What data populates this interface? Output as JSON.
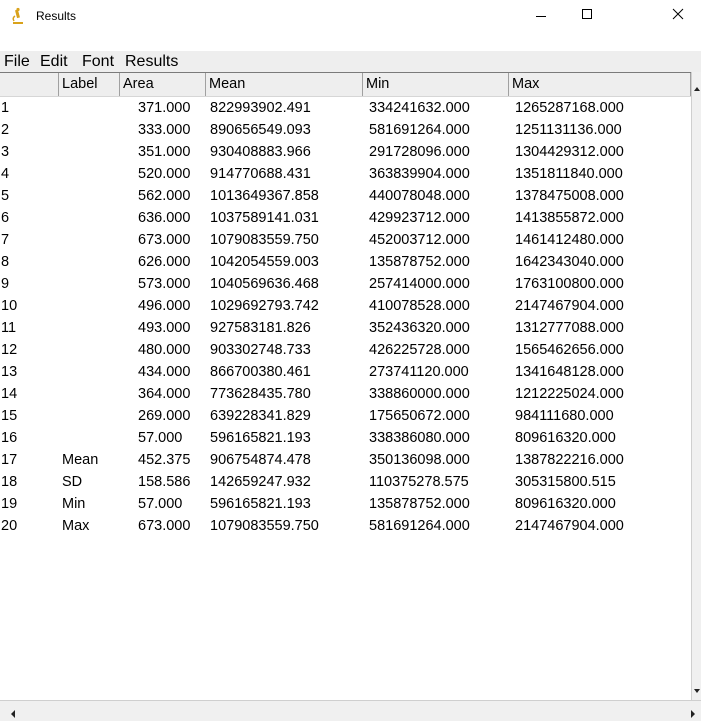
{
  "window": {
    "title": "Results"
  },
  "menu": [
    "File",
    "Edit",
    "Font",
    "Results"
  ],
  "table": {
    "columns": [
      "",
      "Label",
      "Area",
      "Mean",
      "Min",
      "Max"
    ],
    "rows": [
      [
        "1",
        "",
        "371.000",
        "822993902.491",
        "334241632.000",
        "1265287168.000"
      ],
      [
        "2",
        "",
        "333.000",
        "890656549.093",
        "581691264.000",
        "1251131136.000"
      ],
      [
        "3",
        "",
        "351.000",
        "930408883.966",
        "291728096.000",
        "1304429312.000"
      ],
      [
        "4",
        "",
        "520.000",
        "914770688.431",
        "363839904.000",
        "1351811840.000"
      ],
      [
        "5",
        "",
        "562.000",
        "1013649367.858",
        "440078048.000",
        "1378475008.000"
      ],
      [
        "6",
        "",
        "636.000",
        "1037589141.031",
        "429923712.000",
        "1413855872.000"
      ],
      [
        "7",
        "",
        "673.000",
        "1079083559.750",
        "452003712.000",
        "1461412480.000"
      ],
      [
        "8",
        "",
        "626.000",
        "1042054559.003",
        "135878752.000",
        "1642343040.000"
      ],
      [
        "9",
        "",
        "573.000",
        "1040569636.468",
        "257414000.000",
        "1763100800.000"
      ],
      [
        "10",
        "",
        "496.000",
        "1029692793.742",
        "410078528.000",
        "2147467904.000"
      ],
      [
        "11",
        "",
        "493.000",
        "927583181.826",
        "352436320.000",
        "1312777088.000"
      ],
      [
        "12",
        "",
        "480.000",
        "903302748.733",
        "426225728.000",
        "1565462656.000"
      ],
      [
        "13",
        "",
        "434.000",
        "866700380.461",
        "273741120.000",
        "1341648128.000"
      ],
      [
        "14",
        "",
        "364.000",
        "773628435.780",
        "338860000.000",
        "1212225024.000"
      ],
      [
        "15",
        "",
        "269.000",
        "639228341.829",
        "175650672.000",
        "984111680.000"
      ],
      [
        "16",
        "",
        "57.000",
        "596165821.193",
        "338386080.000",
        "809616320.000"
      ],
      [
        "17",
        "Mean",
        "452.375",
        "906754874.478",
        "350136098.000",
        "1387822216.000"
      ],
      [
        "18",
        "SD",
        "158.586",
        "142659247.932",
        "110375278.575",
        "305315800.515"
      ],
      [
        "19",
        "Min",
        "57.000",
        "596165821.193",
        "135878752.000",
        "809616320.000"
      ],
      [
        "20",
        "Max",
        "673.000",
        "1079083559.750",
        "581691264.000",
        "2147467904.000"
      ]
    ]
  },
  "icons": {
    "app": "microscope-icon",
    "minimize": "minimize-icon",
    "maximize": "maximize-icon",
    "close": "close-icon"
  },
  "colors": {
    "menubar_bg": "#eeeeee",
    "header_bg": "#eeeeee",
    "app_icon": "#d9a21b"
  }
}
